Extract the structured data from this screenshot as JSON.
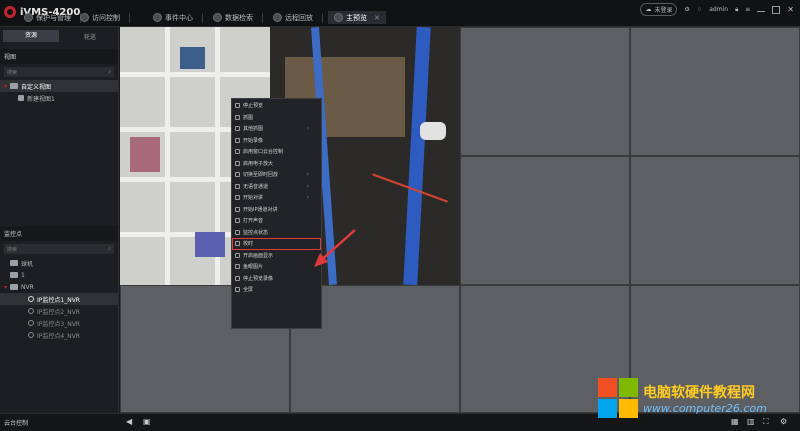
{
  "app": {
    "title": "iVMS-4200"
  },
  "tabs": [
    {
      "label": "保护与管理"
    },
    {
      "label": "访问控制"
    },
    {
      "label": "事件中心"
    },
    {
      "label": "数据检索"
    },
    {
      "label": "远程回放"
    },
    {
      "label": "主预览"
    }
  ],
  "topright": {
    "cloud_label": "未登录",
    "user": "admin"
  },
  "sidebar": {
    "tabs": [
      "资源",
      "轮巡"
    ],
    "view_header": "视图",
    "view_search_placeholder": "搜索",
    "view_items": [
      "自定义视图",
      "新建视图1"
    ],
    "cams_header": "监控点",
    "cams_search_placeholder": "搜索",
    "tree": [
      "球机",
      "1",
      "NVR",
      "IP监控点1_NVR",
      "IP监控点2_NVR",
      "IP监控点3_NVR",
      "IP监控点4_NVR"
    ]
  },
  "context_menu": {
    "items": [
      {
        "label": "停止预览"
      },
      {
        "label": "抓图"
      },
      {
        "label": "其他抓图"
      },
      {
        "label": "开始录像"
      },
      {
        "label": "启用窗口云台控制"
      },
      {
        "label": "启用电子放大"
      },
      {
        "label": "切换至即时回放"
      },
      {
        "label": "无语音通道"
      },
      {
        "label": "开始对讲"
      },
      {
        "label": "开始IP通道对讲"
      },
      {
        "label": "打开声音"
      },
      {
        "label": "监控点状态"
      },
      {
        "label": "校时"
      },
      {
        "label": "开启画面显示"
      },
      {
        "label": "鱼眼图片"
      },
      {
        "label": "停止预览录像"
      },
      {
        "label": "全屏"
      }
    ]
  },
  "bottombar": {
    "label": "云台控制"
  },
  "watermark": {
    "line1": "电脑软硬件教程网",
    "line2": "www.computer26.com"
  },
  "colors": {
    "accent": "#c0262d",
    "highlight": "#e03a3a",
    "cell": "#5e5f62",
    "bg": "#1a1b1d"
  }
}
